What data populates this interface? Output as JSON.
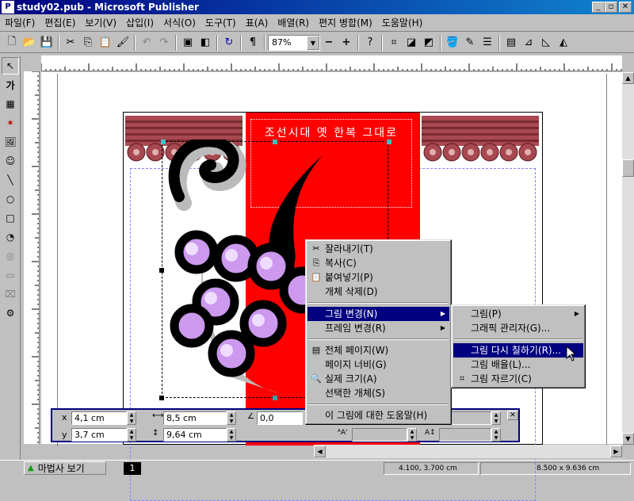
{
  "window": {
    "title": "study02.pub - Microsoft Publisher",
    "icon_label": "P"
  },
  "menubar": [
    "파일(F)",
    "편집(E)",
    "보기(V)",
    "삽입(I)",
    "서식(O)",
    "도구(T)",
    "표(A)",
    "배열(R)",
    "편지 병합(M)",
    "도움말(H)"
  ],
  "toolbar": {
    "zoom": "87%"
  },
  "document": {
    "title_text": "조선시대 옛 한복 그대로"
  },
  "context_menu": {
    "items": [
      "잘라내기(T)",
      "복사(C)",
      "붙여넣기(P)",
      "개체 삭제(D)",
      "그림 변경(N)",
      "프레임 변경(R)",
      "전체 페이지(W)",
      "페이지 너비(G)",
      "실제 크기(A)",
      "선택한 개체(S)",
      "이 그림에 대한 도움말(H)"
    ]
  },
  "submenu": {
    "items": [
      "그림(P)",
      "그래픽 관리자(G)...",
      "그림 다시 칠하기(R)...",
      "그림 배율(L)...",
      "그림 자르기(C)"
    ]
  },
  "measurements": {
    "x": "4,1 cm",
    "y": "3,7 cm",
    "width": "8,5 cm",
    "height": "9,64 cm",
    "rotation": "0,0"
  },
  "statusbar": {
    "wizard": "마법사 보기",
    "page_number": "1",
    "position": "4.100, 3.700 cm",
    "size": "8.500 x 9.636 cm"
  },
  "colors": {
    "title_bar": "#000080",
    "poster_red": "#ff0000",
    "grape": "#cc99ee",
    "highlight": "#000080"
  },
  "icons": [
    "cut-icon",
    "copy-icon",
    "paste-icon",
    "full-page-icon",
    "zoom-icon",
    "crop-icon"
  ]
}
